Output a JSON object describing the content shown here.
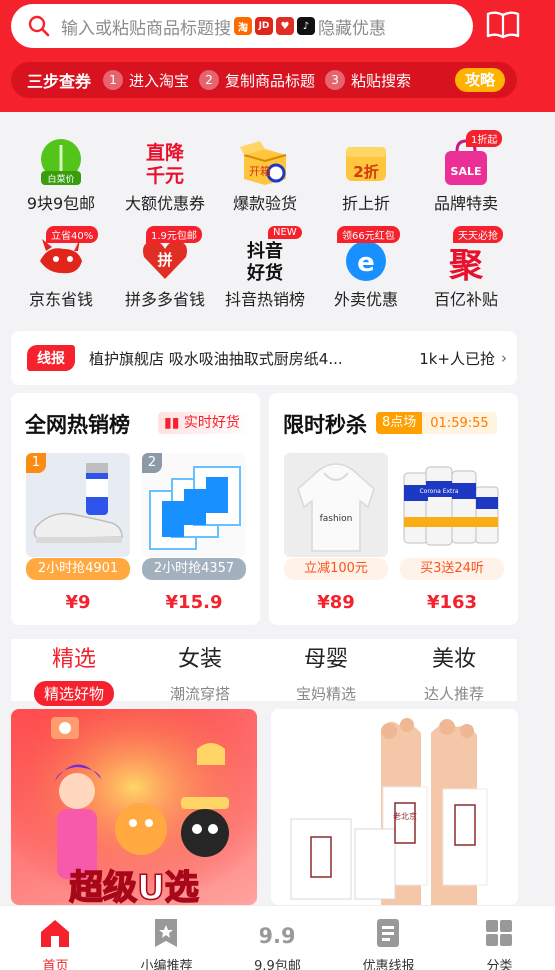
{
  "search": {
    "placeholder_text": "输入或粘贴商品标题搜",
    "platforms": [
      {
        "icon": "taobao-icon",
        "label": "淘",
        "color": "#ff6a00"
      },
      {
        "icon": "jd-icon",
        "label": "JD",
        "color": "#e1251b"
      },
      {
        "icon": "pinduoduo-icon",
        "label": "♥",
        "color": "#e02e24"
      },
      {
        "icon": "douyin-icon",
        "label": "♪",
        "color": "#111111"
      }
    ],
    "suffix_text": "隐藏优惠"
  },
  "steps": {
    "title": "三步查券",
    "items": [
      {
        "num": "1",
        "label": "进入淘宝"
      },
      {
        "num": "2",
        "label": "复制商品标题"
      },
      {
        "num": "3",
        "label": "粘贴搜索"
      }
    ],
    "guide_label": "攻略"
  },
  "grid": {
    "items": [
      {
        "label": "9块9包邮",
        "tag": "",
        "icon": "cabbage-icon",
        "icon_text": "白菜价"
      },
      {
        "label": "大额优惠券",
        "tag": "",
        "icon": "price-drop-icon",
        "icon_text": "直降千元"
      },
      {
        "label": "爆款验货",
        "tag": "",
        "icon": "open-box-icon",
        "icon_text": "开箱"
      },
      {
        "label": "折上折",
        "tag": "",
        "icon": "discount-icon",
        "icon_text": "2折"
      },
      {
        "label": "品牌特卖",
        "tag": "1折起",
        "icon": "sale-bag-icon",
        "icon_text": "SALE"
      },
      {
        "label": "京东省钱",
        "tag": "立省40%",
        "icon": "jd-dog-icon",
        "icon_text": ""
      },
      {
        "label": "拼多多省钱",
        "tag": "1.9元包邮",
        "icon": "pdd-icon",
        "icon_text": "拼"
      },
      {
        "label": "抖音热销榜",
        "tag": "NEW",
        "icon": "douyin-hot-icon",
        "icon_text": "抖音好货"
      },
      {
        "label": "外卖优惠",
        "tag": "领66元红包",
        "icon": "eleme-icon",
        "icon_text": "e"
      },
      {
        "label": "百亿补贴",
        "tag": "天天必抢",
        "icon": "subsidy-icon",
        "icon_text": "聚"
      }
    ]
  },
  "ticker": {
    "badge": "线报",
    "text": "植护旗舰店 吸水吸油抽取式厨房纸4...",
    "count": "1k+人已抢"
  },
  "hot_panel": {
    "title": "全网热销榜",
    "badge": "实时好货",
    "products": [
      {
        "rank": "1",
        "tag": "2小时抢4901",
        "price": "¥9"
      },
      {
        "rank": "2",
        "tag": "2小时抢4357",
        "price": "¥15.9"
      }
    ]
  },
  "flash_panel": {
    "title": "限时秒杀",
    "slot": "8点场",
    "countdown": "01:59:55",
    "products": [
      {
        "tag": "立减100元",
        "price": "¥89",
        "print": "fashion"
      },
      {
        "tag": "买3送24听",
        "price": "¥163",
        "print": "Corona Extra"
      }
    ]
  },
  "tabs": [
    {
      "title": "精选",
      "subtitle": "精选好物",
      "active": true
    },
    {
      "title": "女装",
      "subtitle": "潮流穿搭",
      "active": false
    },
    {
      "title": "母婴",
      "subtitle": "宝妈精选",
      "active": false
    },
    {
      "title": "美妆",
      "subtitle": "达人推荐",
      "active": false
    }
  ],
  "feed": {
    "banner_text": "超级U选",
    "foot_patch_text": "老北京"
  },
  "nav": [
    {
      "label": "首页",
      "icon": "home-icon",
      "active": true
    },
    {
      "label": "小编推荐",
      "icon": "bookmark-star-icon",
      "active": false
    },
    {
      "label": "9.9包邮",
      "icon": "nine-nine-icon",
      "active": false
    },
    {
      "label": "优惠线报",
      "icon": "document-icon",
      "active": false
    },
    {
      "label": "分类",
      "icon": "category-grid-icon",
      "active": false
    }
  ]
}
